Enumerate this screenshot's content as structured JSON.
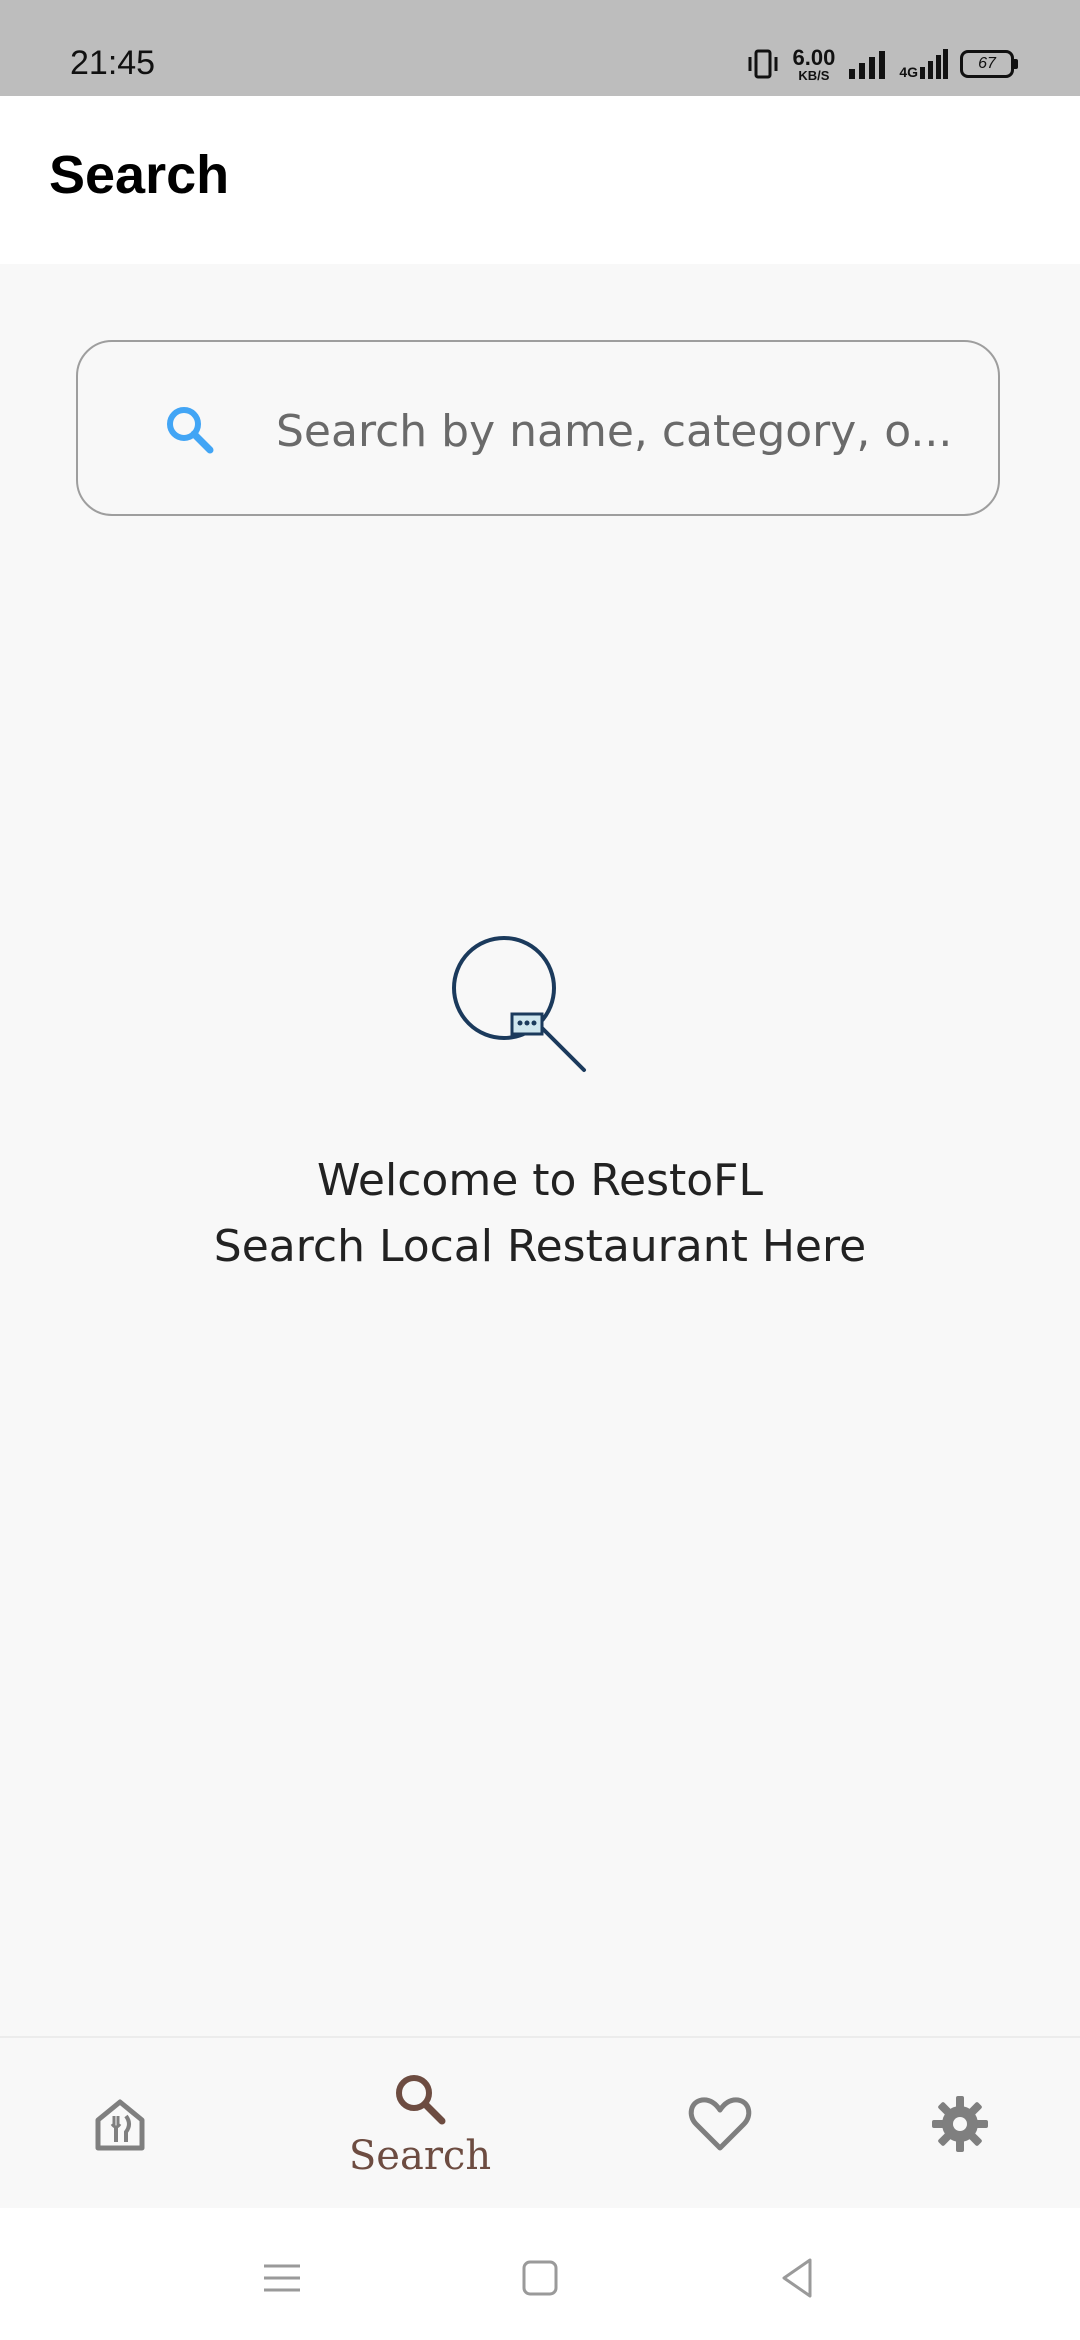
{
  "status_bar": {
    "time": "21:45",
    "net_speed_value": "6.00",
    "net_speed_unit": "KB/S",
    "network_type": "4G",
    "battery_level": "67"
  },
  "app_bar": {
    "title": "Search"
  },
  "search": {
    "placeholder": "Search by name, category, o..."
  },
  "empty_state": {
    "line1": "Welcome to RestoFL",
    "line2": "Search Local Restaurant Here"
  },
  "bottom_nav": {
    "items": [
      {
        "id": "home",
        "icon": "restaurant-home-icon",
        "active": false
      },
      {
        "id": "search",
        "icon": "search-icon",
        "label": "Search",
        "active": true
      },
      {
        "id": "favorites",
        "icon": "heart-icon",
        "active": false
      },
      {
        "id": "settings",
        "icon": "gear-icon",
        "active": false
      }
    ]
  },
  "colors": {
    "accent_blue": "#42a5f5",
    "active_nav": "#6d4c41",
    "inactive_nav": "#7f7f7f",
    "illustration_navy": "#1b3a5c"
  }
}
